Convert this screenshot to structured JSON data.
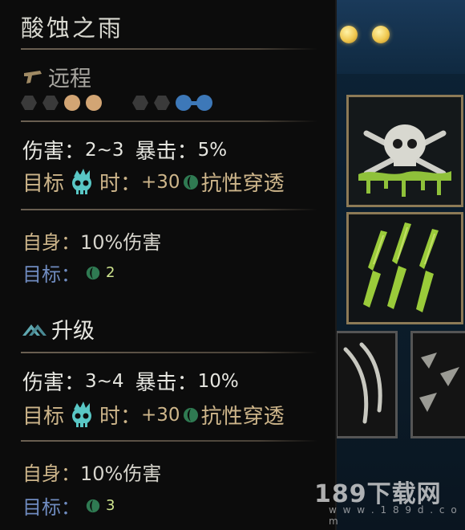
{
  "skill": {
    "name": "酸蚀之雨",
    "type_label": "远程",
    "type_icon": "pistol-icon",
    "positions": {
      "launch_inactive": 2,
      "launch_active": 2,
      "target_inactive": 2,
      "target_active_linked": 2
    },
    "base": {
      "damage_label": "伤害：",
      "damage_value": "2~3",
      "crit_label": "暴击：",
      "crit_value": "5%",
      "target_label": "目标",
      "target_icon": "blighted-skull-icon",
      "time_label": "时：",
      "bonus_value": "+30",
      "bonus_icon": "resist-icon",
      "bonus_label": "抗性穿透",
      "self_label": "自身：",
      "self_value": "10%伤害",
      "target2_label": "目标：",
      "target2_value": "2"
    },
    "upgrade": {
      "header_label": "升级",
      "header_icon": "upgrade-icon",
      "damage_label": "伤害：",
      "damage_value": "3~4",
      "crit_label": "暴击：",
      "crit_value": "10%",
      "target_label": "目标",
      "time_label": "时：",
      "bonus_value": "+30",
      "bonus_label": "抗性穿透",
      "self_label": "自身：",
      "self_value": "10%伤害",
      "target2_label": "目标：",
      "target2_value": "3"
    }
  },
  "watermark": {
    "text": "189下载网",
    "url": "w w w . 1 8 9 d . c o m"
  },
  "colors": {
    "accent_tan": "#cdb58a",
    "accent_blue": "#6f8bc0",
    "accent_green": "#2f7a52",
    "skull_teal": "#59c7c5"
  }
}
